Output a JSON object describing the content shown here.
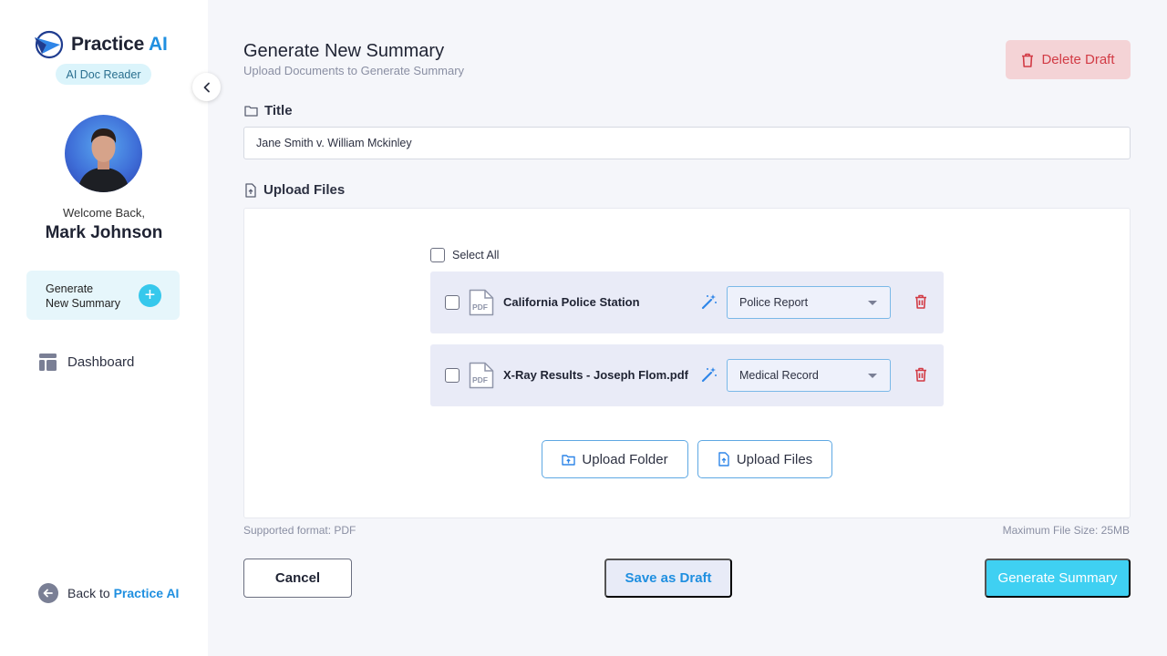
{
  "sidebar": {
    "logo_text_main": "Practice",
    "logo_text_accent": "AI",
    "badge": "AI Doc Reader",
    "welcome": "Welcome Back,",
    "user_name": "Mark Johnson",
    "generate_card": {
      "line1": "Generate",
      "line2": "New Summary"
    },
    "nav": [
      {
        "label": "Dashboard",
        "icon": "dashboard-icon"
      }
    ],
    "back_link": {
      "prefix": "Back to",
      "brand": "Practice AI"
    }
  },
  "header": {
    "title": "Generate New Summary",
    "subtitle": "Upload Documents to Generate Summary",
    "delete_draft_label": "Delete Draft"
  },
  "form": {
    "title_label": "Title",
    "title_value": "Jane Smith v. William Mckinley",
    "upload_label": "Upload Files"
  },
  "files": {
    "select_all_label": "Select All",
    "items": [
      {
        "name": "California Police Station",
        "type": "Police Report"
      },
      {
        "name": "X-Ray Results - Joseph Flom.pdf",
        "type": "Medical Record"
      }
    ],
    "upload_folder_label": "Upload Folder",
    "upload_files_label": "Upload Files"
  },
  "hints": {
    "supported": "Supported format: PDF",
    "max_size": "Maximum File Size: 25MB"
  },
  "actions": {
    "cancel": "Cancel",
    "save_draft": "Save as Draft",
    "generate": "Generate Summary"
  },
  "colors": {
    "accent": "#3fd0f2",
    "brand_blue": "#1f8fe0",
    "danger": "#d23b45",
    "danger_bg": "#f4d3d6"
  }
}
